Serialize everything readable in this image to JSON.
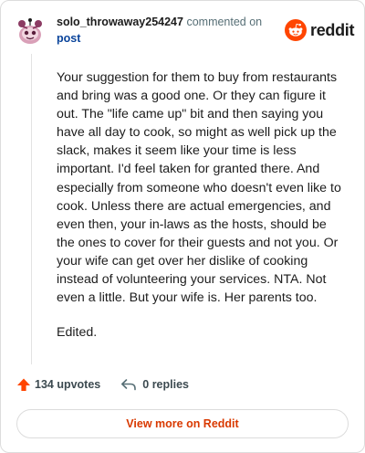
{
  "header": {
    "username": "solo_throwaway254247",
    "action_text": "commented on",
    "target": "post",
    "logo_text": "reddit"
  },
  "comment": {
    "paragraphs": [
      "Your suggestion for them to buy from restaurants and bring was a good one. Or they can figure it out. The \"life came up\" bit and then saying you have all day to cook, so might as well pick up the slack, makes it seem like your time is less important. I'd feel taken for granted there. And especially from someone who doesn't even like to cook. Unless there are actual emergencies, and even then, your in-laws as the hosts, should be the ones to cover for their guests and not you. Or your wife can get over her dislike of cooking instead of volunteering your services. NTA. Not even a little. But your wife is. Her parents too.",
      "Edited."
    ]
  },
  "actions": {
    "upvotes_label": "134 upvotes",
    "replies_label": "0 replies"
  },
  "footer": {
    "view_more_label": "View more on Reddit"
  },
  "colors": {
    "accent": "#d93900",
    "upvote": "#ff4500",
    "link": "#0a449b",
    "muted": "#576f76"
  },
  "icons": {
    "avatar": "snoo-avatar-icon",
    "logo": "reddit-logo-icon",
    "upvote": "upvote-arrow-icon",
    "reply": "reply-arrow-icon"
  }
}
